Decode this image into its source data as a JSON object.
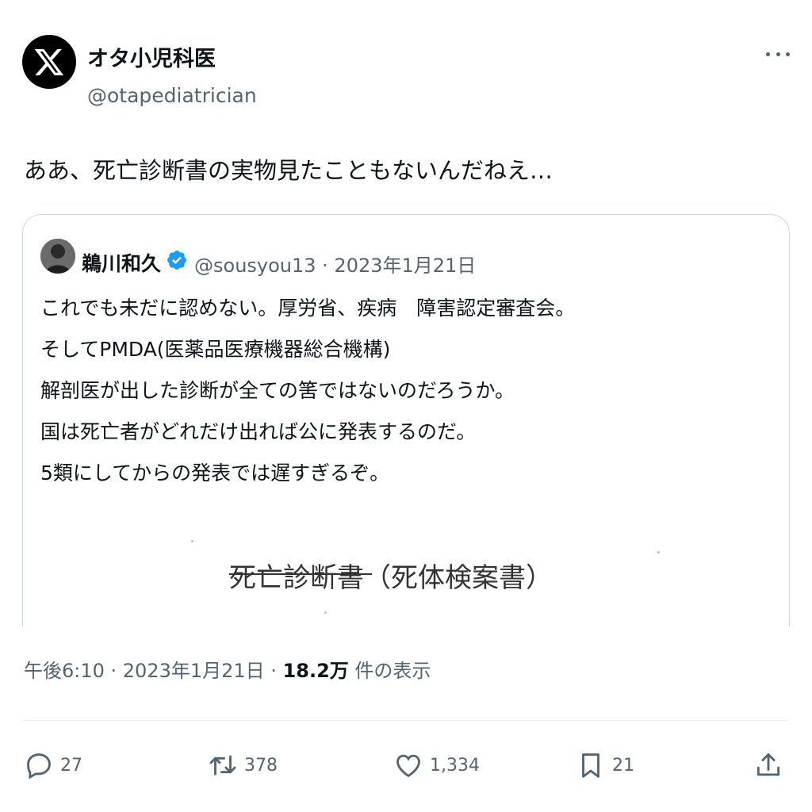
{
  "tweet": {
    "author": {
      "display_name": "オタ小児科医",
      "handle": "@otapediatrician",
      "avatar_icon": "x-logo-icon"
    },
    "text": "ああ、死亡診断書の実物見たこともないんだねえ…",
    "quoted": {
      "author_name": "鵜川和久",
      "verified": true,
      "meta": "@sousyou13 · 2023年1月21日",
      "lines": [
        "これでも未だに認めない。厚労省、疾病　障害認定審査会。",
        "そしてPMDA(医薬品医療機器総合機構)",
        "解剖医が出した診断が全ての筈ではないのだろうか。",
        "国は死亡者がどれだけ出れば公に発表するのだ。",
        "5類にしてからの発表では遅すぎるぞ。"
      ],
      "image_text": "死亡診断書（死体検案書）"
    },
    "meta": {
      "time_date": "午後6:10 · 2023年1月21日 · ",
      "views_count": "18.2万",
      "views_label": " 件の表示"
    },
    "actions": {
      "replies": "27",
      "reposts": "378",
      "likes": "1,334",
      "bookmarks": "21"
    }
  },
  "colors": {
    "text_primary": "#0f1419",
    "text_secondary": "#536471",
    "verified_blue": "#1d9bf0",
    "border": "#cfd9de"
  }
}
